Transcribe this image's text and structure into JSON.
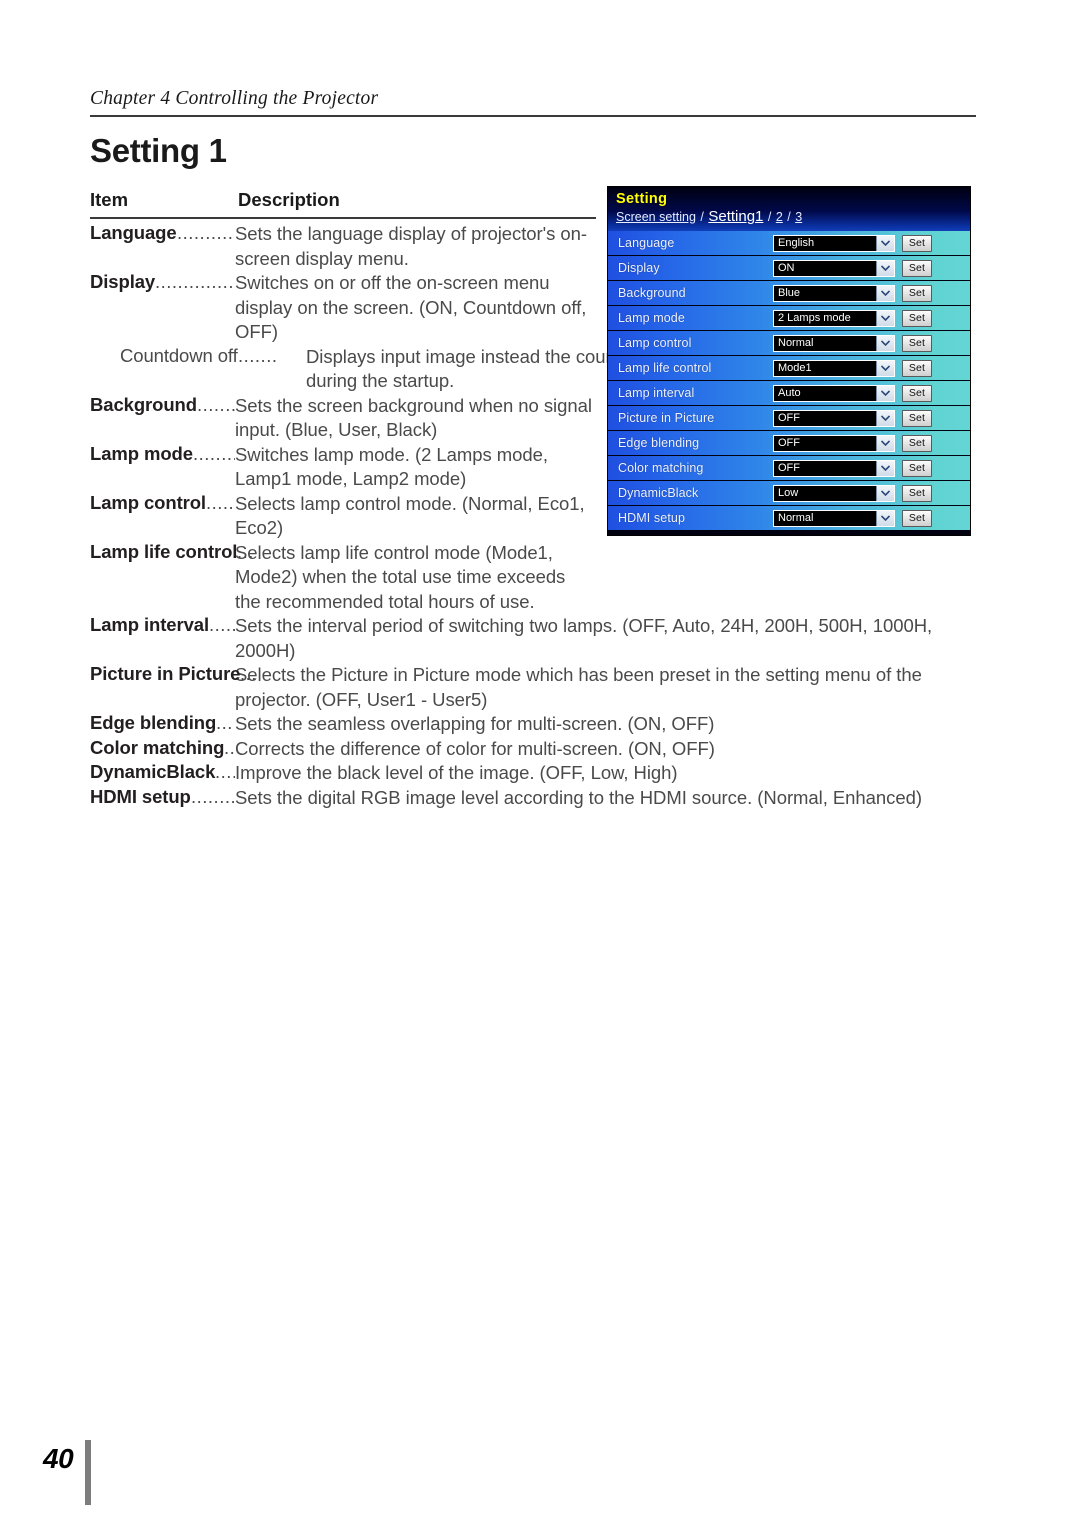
{
  "running_head": "Chapter 4 Controlling the Projector",
  "page_title": "Setting 1",
  "table_header": {
    "item": "Item",
    "description": "Description"
  },
  "entries": [
    {
      "term": "Language",
      "leader": "..............",
      "body": "Sets the language display of projector's on-screen display menu.",
      "width": "narrow",
      "indent": false
    },
    {
      "term": "Display",
      "leader": "...................",
      "body": "Switches on or off the on-screen menu display on the screen. (ON, Countdown off, OFF)",
      "width": "narrow",
      "indent": false
    },
    {
      "term": "Countdown off",
      "leader": ".......",
      "body": "Displays input image instead the countdown during the startup.",
      "width": "narrow",
      "indent": true
    },
    {
      "term": "Background",
      "leader": ".........",
      "body": "Sets the screen background when no signal input. (Blue, User, Black)",
      "width": "narrow",
      "indent": false
    },
    {
      "term": "Lamp mode",
      "leader": ".........",
      "body": "Switches lamp mode. (2 Lamps mode, Lamp1 mode, Lamp2 mode)",
      "width": "narrow",
      "indent": false
    },
    {
      "term": "Lamp control",
      "leader": "......",
      "body": "Selects lamp control mode. (Normal, Eco1, Eco2)",
      "width": "narrow",
      "indent": false
    },
    {
      "term": "Lamp life control",
      "leader": "...",
      "body": "Selects lamp life control mode (Mode1, Mode2) when the total use time exceeds the recommended total hours of use.",
      "width": "narrow",
      "indent": false
    },
    {
      "term": "Lamp interval",
      "leader": ".....",
      "body": "Sets the interval period of switching two lamps. (OFF, Auto, 24H, 200H, 500H, 1000H, 2000H)",
      "width": "wide",
      "indent": false
    },
    {
      "term": "Picture in Picture",
      "leader": "...",
      "body": "Selects the Picture in Picture mode which has been preset in the setting menu of the projector. (OFF, User1 - User5)",
      "width": "wide",
      "indent": false
    },
    {
      "term": "Edge blending",
      "leader": "...",
      "body": "Sets the seamless overlapping for multi-screen. (ON, OFF)",
      "width": "wide",
      "indent": false
    },
    {
      "term": "Color matching",
      "leader": "...",
      "body": "Corrects the difference of color for multi-screen. (ON, OFF)",
      "width": "wide",
      "indent": false
    },
    {
      "term": "DynamicBlack",
      "leader": "....",
      "body": "Improve the black level of the image. (OFF, Low, High)",
      "width": "wide",
      "indent": false
    },
    {
      "term": "HDMI setup",
      "leader": ".........",
      "body": "Sets the digital RGB image level according to the HDMI source. (Normal, Enhanced)",
      "width": "wide",
      "indent": false
    }
  ],
  "panel": {
    "title": "Setting",
    "breadcrumb": {
      "screen_setting": "Screen setting",
      "sep1": " / ",
      "setting1": "Setting1",
      "sep2": " / ",
      "page2": "2",
      "sep3": " / ",
      "page3": "3"
    },
    "set_label": "Set",
    "rows": [
      {
        "label": "Language",
        "value": "English"
      },
      {
        "label": "Display",
        "value": "ON"
      },
      {
        "label": "Background",
        "value": "Blue"
      },
      {
        "label": "Lamp mode",
        "value": "2 Lamps mode"
      },
      {
        "label": "Lamp control",
        "value": "Normal"
      },
      {
        "label": "Lamp life control",
        "value": "Mode1"
      },
      {
        "label": "Lamp interval",
        "value": "Auto"
      },
      {
        "label": "Picture in Picture",
        "value": "OFF"
      },
      {
        "label": "Edge blending",
        "value": "OFF"
      },
      {
        "label": "Color matching",
        "value": "OFF"
      },
      {
        "label": "DynamicBlack",
        "value": "Low"
      },
      {
        "label": "HDMI setup",
        "value": "Normal"
      }
    ],
    "colors": {
      "title_text": "#ffff00",
      "header_bg": "#00094a",
      "row_left": "#1f4fe0",
      "row_right": "#63d6d4",
      "select_bg": "#000000"
    }
  },
  "footer": {
    "page_number": "40"
  }
}
